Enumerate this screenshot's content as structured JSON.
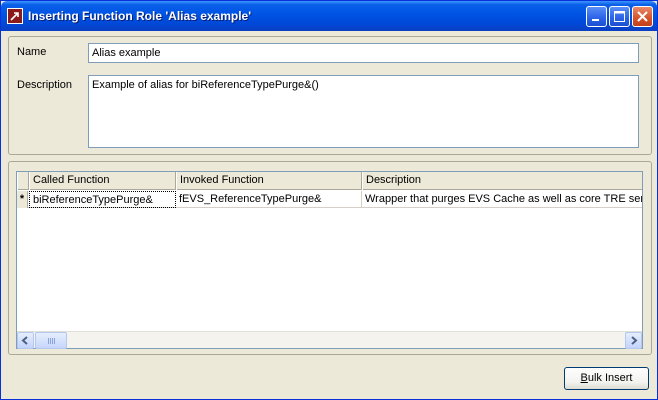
{
  "window": {
    "title": "Inserting Function Role 'Alias example'",
    "controls": [
      "minimize-icon",
      "maximize-icon",
      "close-icon"
    ]
  },
  "form": {
    "name_label": "Name",
    "name_value": "Alias example",
    "description_label": "Description",
    "description_value": "Example of alias for biReferenceTypePurge&()"
  },
  "grid": {
    "columns": [
      "Called Function",
      "Invoked Function",
      "Description"
    ],
    "rows": [
      {
        "marker": "*",
        "called": "biReferenceTypePurge&",
        "invoked": "fEVS_ReferenceTypePurge&",
        "description": "Wrapper that purges EVS Cache as well as core TRE serv"
      }
    ]
  },
  "buttons": {
    "bulk_insert_prefix": "B",
    "bulk_insert_rest": "ulk Insert"
  },
  "colors": {
    "titlebar": "#0055e5",
    "window_bg": "#ece9d8",
    "close_button": "#d4532a"
  }
}
